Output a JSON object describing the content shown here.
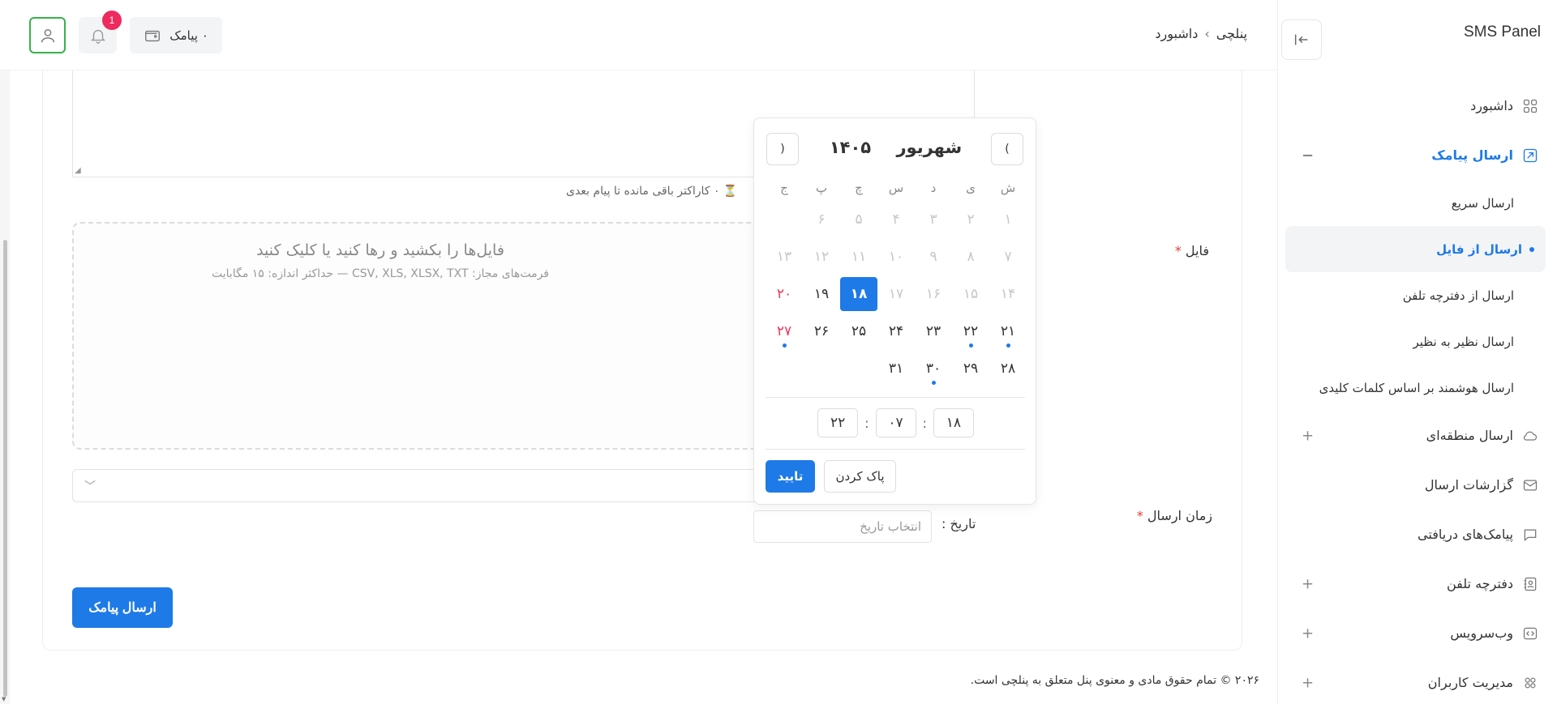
{
  "app": {
    "title": "SMS Panel"
  },
  "header": {
    "breadcrumb": [
      "پنلچی",
      "داشبورد"
    ],
    "credit_label": "۰ پیامک",
    "notification_count": "1"
  },
  "sidebar": {
    "items": [
      {
        "label": "داشبورد",
        "icon": "grid-icon"
      },
      {
        "label": "ارسال پیامک",
        "icon": "send-icon",
        "toggle": "−",
        "active": true
      },
      {
        "label": "ارسال منطقه‌ای",
        "icon": "cloud-icon",
        "toggle": "+"
      },
      {
        "label": "گزارشات ارسال",
        "icon": "mail-icon"
      },
      {
        "label": "پیامک‌های دریافتی",
        "icon": "chat-icon"
      },
      {
        "label": "دفترچه تلفن",
        "icon": "contacts-icon",
        "toggle": "+"
      },
      {
        "label": "وب‌سرویس",
        "icon": "code-icon",
        "toggle": "+"
      },
      {
        "label": "مدیریت کاربران",
        "icon": "users-icon",
        "toggle": "+"
      }
    ],
    "subitems": [
      {
        "label": "ارسال سریع"
      },
      {
        "label": "ارسال از فایل",
        "active": true
      },
      {
        "label": "ارسال از دفترچه تلفن"
      },
      {
        "label": "ارسال نظیر به نظیر"
      },
      {
        "label": "ارسال هوشمند بر اساس کلمات کلیدی"
      }
    ]
  },
  "form": {
    "char_note": "⏳ ۰ کاراکتر باقی مانده تا پیام بعدی",
    "file_label": "فایل",
    "required_mark": "*",
    "dropzone_title": "فایل‌ها را بکشید و رها کنید یا کلیک کنید",
    "dropzone_sub": "فرمت‌های مجاز: CSV, XLS, XLSX, TXT — حداکثر اندازه: ۱۵ مگابایت",
    "send_time_label": "زمان ارسال",
    "date_label": "تاریخ :",
    "date_placeholder": "انتخاب تاریخ",
    "send_button": "ارسال پیامک"
  },
  "calendar": {
    "month": "شهریور",
    "year": "۱۴۰۵",
    "prev": "(",
    "next": ")",
    "weekdays": [
      "ش",
      "ی",
      "د",
      "س",
      "چ",
      "پ",
      "ج"
    ],
    "weeks": [
      [
        {
          "d": "۱",
          "s": "dis"
        },
        {
          "d": "۲",
          "s": "dis"
        },
        {
          "d": "۳",
          "s": "dis"
        },
        {
          "d": "۴",
          "s": "dis"
        },
        {
          "d": "۵",
          "s": "dis"
        },
        {
          "d": "۶",
          "s": "dis"
        },
        {
          "d": "",
          "s": ""
        }
      ],
      [
        {
          "d": "۷",
          "s": "dis"
        },
        {
          "d": "۸",
          "s": "dis"
        },
        {
          "d": "۹",
          "s": "dis"
        },
        {
          "d": "۱۰",
          "s": "dis"
        },
        {
          "d": "۱۱",
          "s": "dis"
        },
        {
          "d": "۱۲",
          "s": "dis"
        },
        {
          "d": "۱۳",
          "s": "dis"
        }
      ],
      [
        {
          "d": "۱۴",
          "s": "dis"
        },
        {
          "d": "۱۵",
          "s": "dis"
        },
        {
          "d": "۱۶",
          "s": "dis"
        },
        {
          "d": "۱۷",
          "s": "dis"
        },
        {
          "d": "۱۸",
          "s": "sel"
        },
        {
          "d": "۱۹",
          "s": ""
        },
        {
          "d": "۲۰",
          "s": "fri"
        }
      ],
      [
        {
          "d": "۲۱",
          "s": "dot"
        },
        {
          "d": "۲۲",
          "s": "dot"
        },
        {
          "d": "۲۳",
          "s": ""
        },
        {
          "d": "۲۴",
          "s": ""
        },
        {
          "d": "۲۵",
          "s": ""
        },
        {
          "d": "۲۶",
          "s": ""
        },
        {
          "d": "۲۷",
          "s": "fri dot"
        }
      ],
      [
        {
          "d": "۲۸",
          "s": ""
        },
        {
          "d": "۲۹",
          "s": ""
        },
        {
          "d": "۳۰",
          "s": "dot"
        },
        {
          "d": "۳۱",
          "s": ""
        },
        {
          "d": "",
          "s": ""
        },
        {
          "d": "",
          "s": ""
        },
        {
          "d": "",
          "s": ""
        }
      ]
    ],
    "time": {
      "hour": "۱۸",
      "minute": "۰۷",
      "second": "۲۲",
      "sep": ":"
    },
    "clear_label": "پاک کردن",
    "confirm_label": "تایید"
  },
  "footer": {
    "text": "۲۰۲۶ © تمام حقوق مادی و معنوی پنل متعلق به پنلچی است."
  }
}
